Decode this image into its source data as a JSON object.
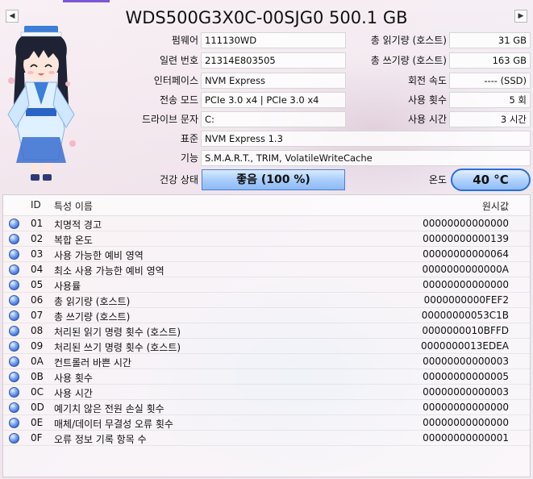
{
  "title": "WDS500G3X0C-00SJG0 500.1 GB",
  "nav": {
    "prev": "◀",
    "next": "▶"
  },
  "info": {
    "firmware": {
      "label": "펌웨어",
      "value": "111130WD"
    },
    "serial": {
      "label": "일련 번호",
      "value": "21314E803505"
    },
    "interface": {
      "label": "인터페이스",
      "value": "NVM Express"
    },
    "transfer_mode": {
      "label": "전송 모드",
      "value": "PCIe 3.0 x4 | PCIe 3.0 x4"
    },
    "drive_letter": {
      "label": "드라이브 문자",
      "value": "C:"
    },
    "standard": {
      "label": "표준",
      "value": "NVM Express 1.3"
    },
    "features": {
      "label": "기능",
      "value": "S.M.A.R.T., TRIM, VolatileWriteCache"
    },
    "host_reads": {
      "label": "총 읽기량 (호스트)",
      "value": "31 GB"
    },
    "host_writes": {
      "label": "총 쓰기량 (호스트)",
      "value": "163 GB"
    },
    "rotation": {
      "label": "회전 속도",
      "value": "---- (SSD)"
    },
    "power_count": {
      "label": "사용 횟수",
      "value": "5 회"
    },
    "power_hours": {
      "label": "사용 시간",
      "value": "3 시간"
    }
  },
  "health": {
    "label": "건강 상태",
    "value": "좋음  (100 %)",
    "color": "#9cc4f8"
  },
  "temperature": {
    "label": "온도",
    "value": "40 °C",
    "color": "#2b6fd6"
  },
  "table": {
    "columns": {
      "id": "ID",
      "name": "특성 이름",
      "raw": "원시값"
    },
    "rows": [
      {
        "id": "01",
        "name": "치명적 경고",
        "raw": "00000000000000"
      },
      {
        "id": "02",
        "name": "복합 온도",
        "raw": "00000000000139"
      },
      {
        "id": "03",
        "name": "사용 가능한 예비 영역",
        "raw": "00000000000064"
      },
      {
        "id": "04",
        "name": "최소 사용 가능한 예비 영역",
        "raw": "0000000000000A"
      },
      {
        "id": "05",
        "name": "사용률",
        "raw": "00000000000000"
      },
      {
        "id": "06",
        "name": "총 읽기량 (호스트)",
        "raw": "0000000000FEF2"
      },
      {
        "id": "07",
        "name": "총 쓰기량 (호스트)",
        "raw": "00000000053C1B"
      },
      {
        "id": "08",
        "name": "처리된 읽기 명령 횟수 (호스트)",
        "raw": "0000000010BFFD"
      },
      {
        "id": "09",
        "name": "처리된 쓰기 명령 횟수 (호스트)",
        "raw": "0000000013EDEA"
      },
      {
        "id": "0A",
        "name": "컨트롤러 바쁜 시간",
        "raw": "00000000000003"
      },
      {
        "id": "0B",
        "name": "사용 횟수",
        "raw": "00000000000005"
      },
      {
        "id": "0C",
        "name": "사용 시간",
        "raw": "00000000000003"
      },
      {
        "id": "0D",
        "name": "예기치 않은 전원 손실 횟수",
        "raw": "00000000000000"
      },
      {
        "id": "0E",
        "name": "매체/데이터 무결성 오류 횟수",
        "raw": "00000000000000"
      },
      {
        "id": "0F",
        "name": "오류 정보 기록 항목 수",
        "raw": "00000000000001"
      }
    ]
  },
  "colors": {
    "accent": "#7b57d6",
    "status_dot": "#3d6fd9"
  }
}
